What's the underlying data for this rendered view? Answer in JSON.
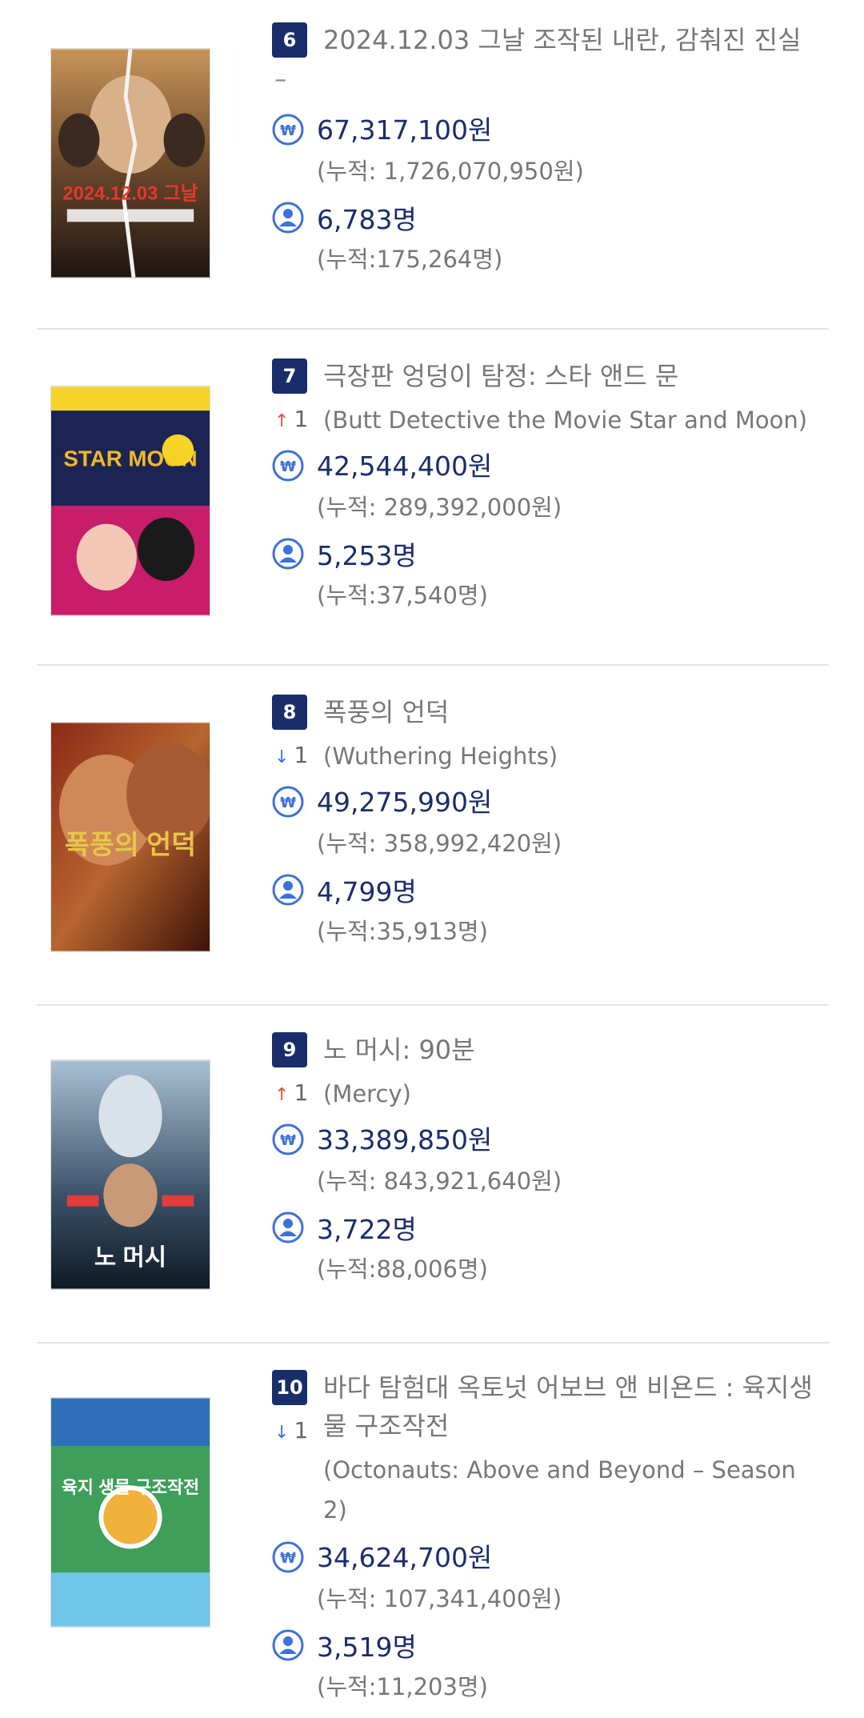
{
  "colors": {
    "rank_badge": "#1a2d6b",
    "stat_text": "#1a2d6b",
    "secondary_text": "#777777",
    "rank_up": "#e04a43",
    "rank_down": "#3e71d6",
    "icon_blue": "#3e71d6"
  },
  "movies": [
    {
      "rank": "6",
      "title": "2024.12.03 그날 조작된 내란, 감춰진 진실",
      "original_title": "",
      "rank_change": {
        "direction": "none",
        "value": "–"
      },
      "revenue": "67,317,100원",
      "revenue_total": "(누적: 1,726,070,950원)",
      "audience": "6,783명",
      "audience_total": "(누적:175,264명)",
      "poster_icon": "movie-poster",
      "poster_text": "2024.12.03 그날"
    },
    {
      "rank": "7",
      "title": "극장판 엉덩이 탐정: 스타 앤드 문",
      "original_title": "(Butt Detective the Movie Star and Moon)",
      "rank_change": {
        "direction": "up",
        "value": "1"
      },
      "revenue": "42,544,400원",
      "revenue_total": "(누적: 289,392,000원)",
      "audience": "5,253명",
      "audience_total": "(누적:37,540명)",
      "poster_icon": "movie-poster",
      "poster_text": "STAR MOON"
    },
    {
      "rank": "8",
      "title": "폭풍의 언덕",
      "original_title": "(Wuthering Heights)",
      "rank_change": {
        "direction": "down",
        "value": "1"
      },
      "revenue": "49,275,990원",
      "revenue_total": "(누적: 358,992,420원)",
      "audience": "4,799명",
      "audience_total": "(누적:35,913명)",
      "poster_icon": "movie-poster",
      "poster_text": "폭풍의 언덕"
    },
    {
      "rank": "9",
      "title": "노 머시: 90분",
      "original_title": "(Mercy)",
      "rank_change": {
        "direction": "up",
        "value": "1"
      },
      "revenue": "33,389,850원",
      "revenue_total": "(누적: 843,921,640원)",
      "audience": "3,722명",
      "audience_total": "(누적:88,006명)",
      "poster_icon": "movie-poster",
      "poster_text": "노 머시"
    },
    {
      "rank": "10",
      "title": "바다 탐험대 옥토넛 어보브 앤 비욘드 : 육지생물 구조작전",
      "original_title": "(Octonauts: Above and Beyond – Season 2)",
      "rank_change": {
        "direction": "down",
        "value": "1"
      },
      "revenue": "34,624,700원",
      "revenue_total": "(누적: 107,341,400원)",
      "audience": "3,519명",
      "audience_total": "(누적:11,203명)",
      "poster_icon": "movie-poster",
      "poster_text": "육지 생물 구조작전"
    }
  ]
}
